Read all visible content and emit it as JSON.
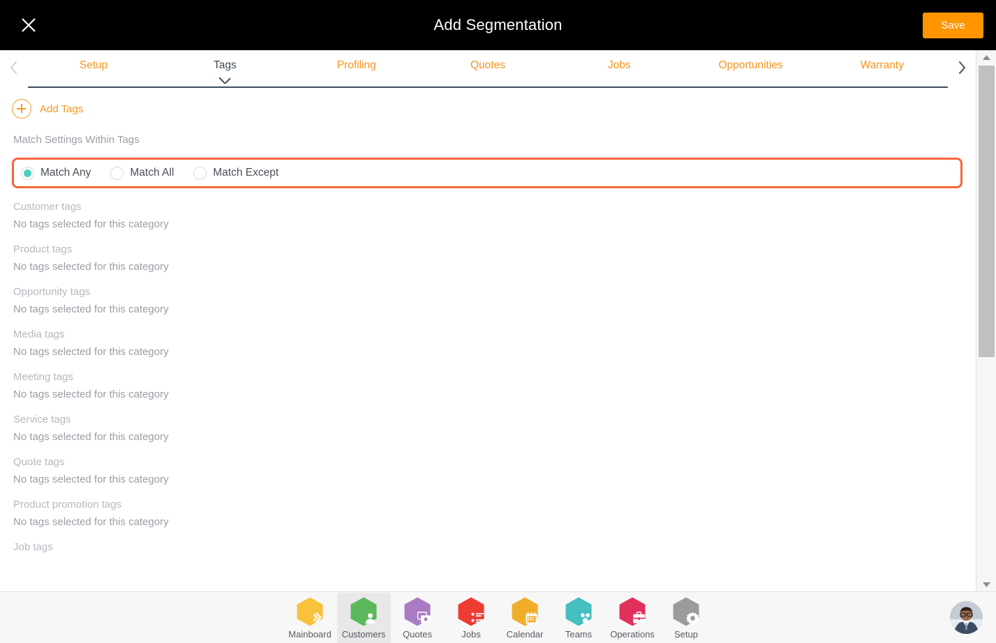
{
  "header": {
    "title": "Add Segmentation",
    "close_icon": "close-icon",
    "save_label": "Save"
  },
  "tabbar": {
    "prev_icon": "chevron-left-icon",
    "next_icon": "chevron-right-icon",
    "active_tab": "Tags",
    "tabs": [
      {
        "label": "Setup",
        "active": false
      },
      {
        "label": "Tags",
        "active": true
      },
      {
        "label": "Profiling",
        "active": false
      },
      {
        "label": "Quotes",
        "active": false
      },
      {
        "label": "Jobs",
        "active": false
      },
      {
        "label": "Opportunities",
        "active": false
      },
      {
        "label": "Warranty",
        "active": false
      }
    ]
  },
  "content": {
    "add_tags_label": "Add Tags",
    "add_tags_icon": "plus-circle-icon",
    "match_settings_label": "Match Settings Within Tags",
    "match_options": [
      {
        "label": "Match Any",
        "selected": true
      },
      {
        "label": "Match All",
        "selected": false
      },
      {
        "label": "Match Except",
        "selected": false
      }
    ],
    "empty_text": "No tags selected for this category",
    "tag_categories": [
      {
        "name": "Customer tags",
        "value": "No tags selected for this category"
      },
      {
        "name": "Product tags",
        "value": "No tags selected for this category"
      },
      {
        "name": "Opportunity tags",
        "value": "No tags selected for this category"
      },
      {
        "name": "Media tags",
        "value": "No tags selected for this category"
      },
      {
        "name": "Meeting tags",
        "value": "No tags selected for this category"
      },
      {
        "name": "Service tags",
        "value": "No tags selected for this category"
      },
      {
        "name": "Quote tags",
        "value": "No tags selected for this category"
      },
      {
        "name": "Product promotion tags",
        "value": "No tags selected for this category"
      },
      {
        "name": "Job tags",
        "value": ""
      }
    ]
  },
  "scrollbar": {
    "up_icon": "scroll-up-arrow-icon",
    "down_icon": "scroll-down-arrow-icon"
  },
  "bottom_nav": {
    "active_item": "Customers",
    "items": [
      {
        "label": "Mainboard",
        "icon": "mainboard-icon",
        "color": "#F9C23C",
        "active": false
      },
      {
        "label": "Customers",
        "icon": "customers-icon",
        "color": "#5CB85C",
        "active": true
      },
      {
        "label": "Quotes",
        "icon": "quotes-icon",
        "color": "#A97BC4",
        "active": false
      },
      {
        "label": "Jobs",
        "icon": "jobs-icon",
        "color": "#EE3B33",
        "active": false
      },
      {
        "label": "Calendar",
        "icon": "calendar-icon",
        "color": "#F0AD29",
        "active": false
      },
      {
        "label": "Teams",
        "icon": "teams-icon",
        "color": "#45BFBF",
        "active": false
      },
      {
        "label": "Operations",
        "icon": "operations-icon",
        "color": "#E0315B",
        "active": false
      },
      {
        "label": "Setup",
        "icon": "setup-icon",
        "color": "#9B9B9B",
        "active": false
      }
    ],
    "avatar_icon": "user-avatar"
  },
  "colors": {
    "accent_orange": "#F7941E",
    "save_orange": "#FF9500",
    "highlight_border": "#F4663B",
    "radio_teal": "#4ECDC4",
    "tab_underline": "#3c4a5a",
    "header_bg": "#000000"
  }
}
